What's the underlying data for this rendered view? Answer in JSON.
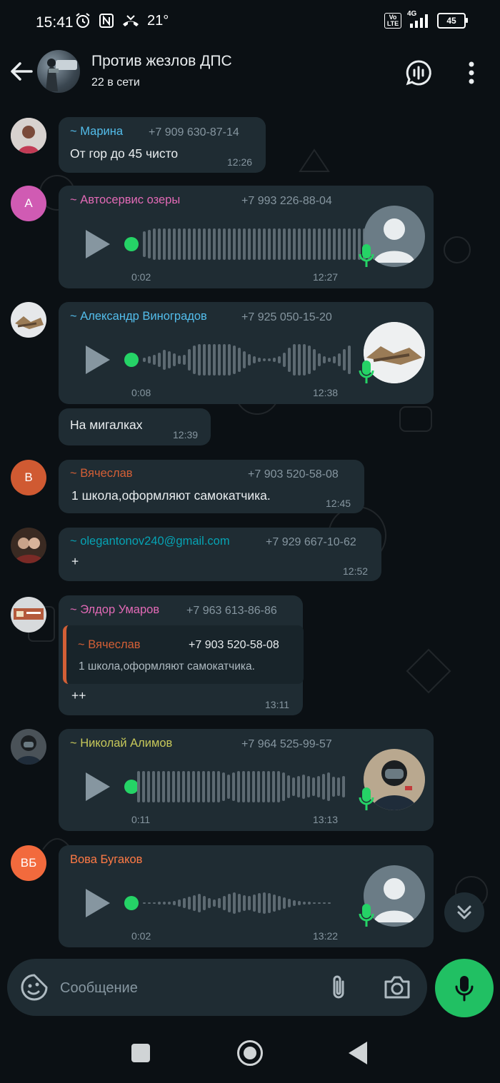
{
  "status_bar": {
    "time": "15:41",
    "temperature": "21°",
    "network": "4G",
    "volte": "Vo LTE",
    "battery": "45"
  },
  "header": {
    "title": "Против жезлов ДПС",
    "subtitle": "22 в сети"
  },
  "messages": [
    {
      "sender": "~ Марина",
      "phone": "+7 909 630-87-14",
      "text": "От гор до 45 чисто",
      "time": "12:26",
      "sender_color": "#53bdeb"
    },
    {
      "avatar_letter": "A",
      "sender": "~ Автосервис озеры",
      "phone": "+7 993 226-88-04",
      "duration": "0:02",
      "time": "12:27",
      "sender_color": "#e26ab6"
    },
    {
      "sender": "~ Александр Виноградов",
      "phone": "+7 925 050-15-20",
      "duration": "0:08",
      "time": "12:38",
      "sender_color": "#53bdeb"
    },
    {
      "text": "На мигалках",
      "time": "12:39"
    },
    {
      "avatar_letter": "B",
      "sender": "~ Вячеслав",
      "phone": "+7 903 520-58-08",
      "text": "1 школа,оформляют самокатчика.",
      "time": "12:45",
      "sender_color": "#d35f36"
    },
    {
      "sender": "~ olegantonov240@gmail.com",
      "phone": "+7 929 667-10-62",
      "text": "+",
      "time": "12:52",
      "sender_color": "#06a3b4"
    },
    {
      "sender": "~ Элдор Умаров",
      "phone": "+7 963 613-86-86",
      "quote_sender": "~ Вячеслав",
      "quote_phone": "+7 903 520-58-08",
      "quote_text": "1 школа,оформляют самокатчика.",
      "text": "++",
      "time": "13:11",
      "sender_color": "#e26ab6"
    },
    {
      "sender": "~ Николай Алимов",
      "phone": "+7 964 525-99-57",
      "duration": "0:11",
      "time": "13:13",
      "sender_color": "#c7c85a"
    },
    {
      "avatar_letter": "ВБ",
      "sender": "Вова Бугаков",
      "duration": "0:02",
      "time": "13:22",
      "sender_color": "#ff7a45"
    }
  ],
  "composer": {
    "placeholder": "Сообщение"
  },
  "icons": {
    "back": "back-arrow-icon",
    "voice_chat": "voice-chat-icon",
    "menu": "more-vert-icon",
    "sticker": "sticker-icon",
    "attach": "paperclip-icon",
    "camera": "camera-icon",
    "mic": "mic-icon"
  },
  "colors": {
    "bubble": "#1f2c33",
    "background": "#0b1014",
    "accent": "#21c063"
  }
}
